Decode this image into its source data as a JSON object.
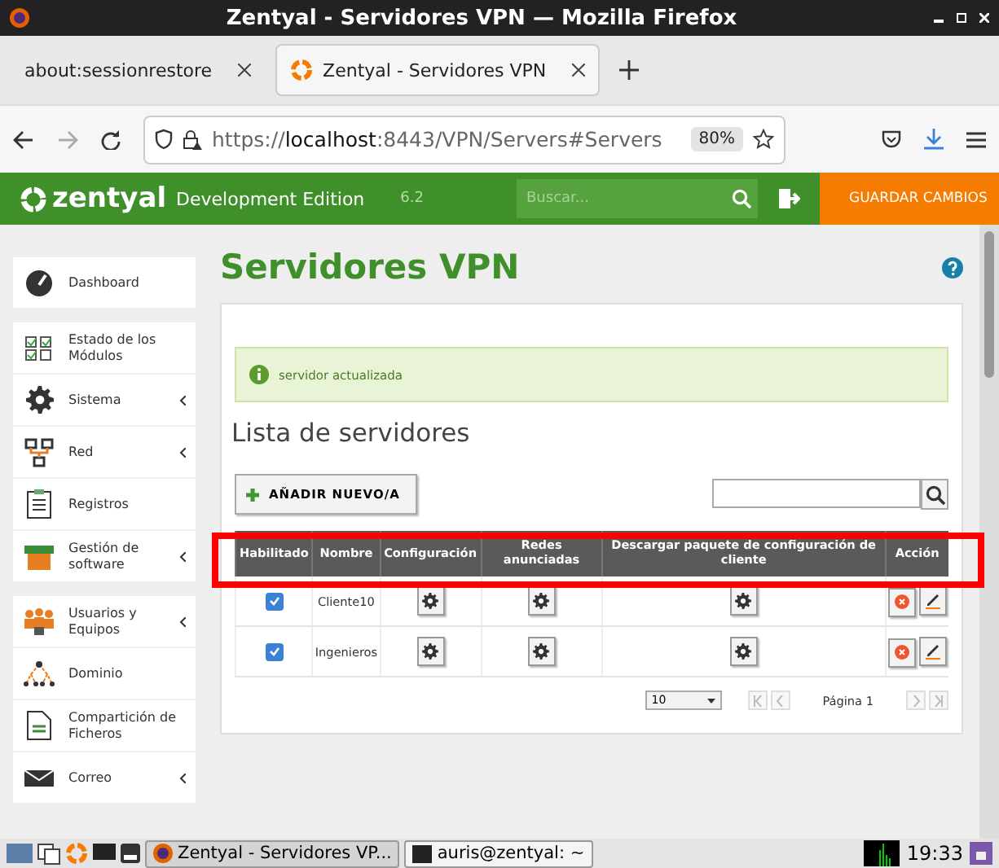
{
  "window": {
    "title": "Zentyal - Servidores VPN — Mozilla Firefox"
  },
  "browser_tabs": [
    {
      "label": "about:sessionrestore",
      "selected": false
    },
    {
      "label": "Zentyal - Servidores VPN",
      "selected": true
    }
  ],
  "address_bar": {
    "scheme": "https://",
    "host": "localhost",
    "path": ":8443/VPN/Servers#Servers",
    "zoom": "80%"
  },
  "header": {
    "brand": "zentyal",
    "edition": "Development Edition",
    "version": "6.2",
    "search_placeholder": "Buscar...",
    "save_label": "GUARDAR CAMBIOS"
  },
  "sidebar": {
    "groups": [
      {
        "items": [
          {
            "label": "Dashboard",
            "kind": "gauge",
            "has_submenu": false
          }
        ]
      },
      {
        "items": [
          {
            "label": "Estado de los Módulos",
            "kind": "checks",
            "has_submenu": false
          },
          {
            "label": "Sistema",
            "kind": "gear",
            "has_submenu": true
          },
          {
            "label": "Red",
            "kind": "network",
            "has_submenu": true
          },
          {
            "label": "Registros",
            "kind": "clipboard",
            "has_submenu": false
          },
          {
            "label": "Gestión de software",
            "kind": "box",
            "has_submenu": true
          }
        ]
      },
      {
        "items": [
          {
            "label": "Usuarios y Equipos",
            "kind": "users",
            "has_submenu": true
          },
          {
            "label": "Dominio",
            "kind": "tree",
            "has_submenu": false
          },
          {
            "label": "Compartición de Ficheros",
            "kind": "file",
            "has_submenu": false
          },
          {
            "label": "Correo",
            "kind": "mail",
            "has_submenu": true
          }
        ]
      }
    ]
  },
  "page": {
    "title": "Servidores VPN",
    "notice": "servidor actualizada",
    "section_title": "Lista de servidores",
    "add_button": "AÑADIR NUEVO/A"
  },
  "table": {
    "columns": [
      "Habilitado",
      "Nombre",
      "Configuración",
      "Redes anunciadas",
      "Descargar paquete de configuración de cliente",
      "Acción"
    ],
    "rows": [
      {
        "enabled": true,
        "name": "Cliente10"
      },
      {
        "enabled": true,
        "name": "Ingenieros"
      }
    ]
  },
  "pagination": {
    "page_size": "10",
    "page_label": "Página 1"
  },
  "taskbar": {
    "items": [
      {
        "label": "Zentyal - Servidores VP...",
        "kind": "firefox",
        "selected": true
      },
      {
        "label": "auris@zentyal: ~",
        "kind": "terminal",
        "selected": false
      }
    ],
    "clock": "19:33"
  }
}
